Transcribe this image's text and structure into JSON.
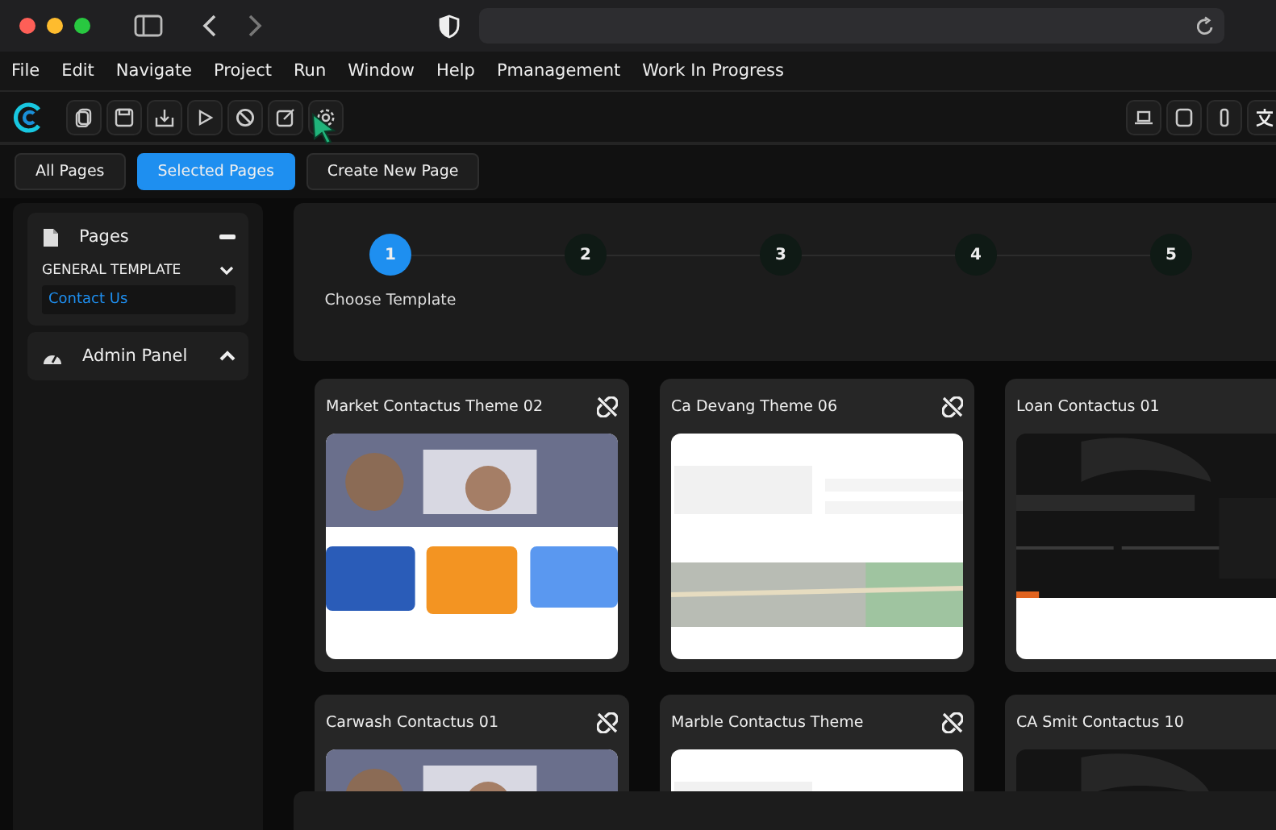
{
  "menu": [
    "File",
    "Edit",
    "Navigate",
    "Project",
    "Run",
    "Window",
    "Help",
    "Pmanagement",
    "Work In Progress"
  ],
  "view_tabs": [
    {
      "label": "All Pages",
      "selected": false
    },
    {
      "label": "Selected Pages",
      "selected": true
    },
    {
      "label": "Create New Page",
      "selected": false
    }
  ],
  "sidebar": {
    "sections": [
      {
        "title": "Pages",
        "expanded": true,
        "groups": [
          {
            "title": "GENERAL TEMPLATE",
            "expanded": true,
            "items": [
              {
                "label": "Contact Us",
                "selected": true
              }
            ]
          }
        ]
      },
      {
        "title": "Admin Panel",
        "expanded": false
      }
    ]
  },
  "stepper": {
    "steps": [
      {
        "number": "1",
        "label": "Choose Template",
        "selected": true
      },
      {
        "number": "2",
        "selected": false
      },
      {
        "number": "3",
        "selected": false
      },
      {
        "number": "4",
        "selected": false
      },
      {
        "number": "5",
        "selected": false
      }
    ]
  },
  "templates": [
    {
      "title": "Market Contactus Theme 02",
      "kind": "picture"
    },
    {
      "title": "Ca Devang Theme 06",
      "kind": "picture"
    },
    {
      "title": "Loan Contactus 01",
      "kind": "picture"
    },
    {
      "title": "Carwash Contactus 01",
      "kind": "picture"
    },
    {
      "title": "Marble Contactus Theme",
      "kind": "picture"
    },
    {
      "title": "CA Smit Contactus 10",
      "kind": "picture"
    }
  ]
}
